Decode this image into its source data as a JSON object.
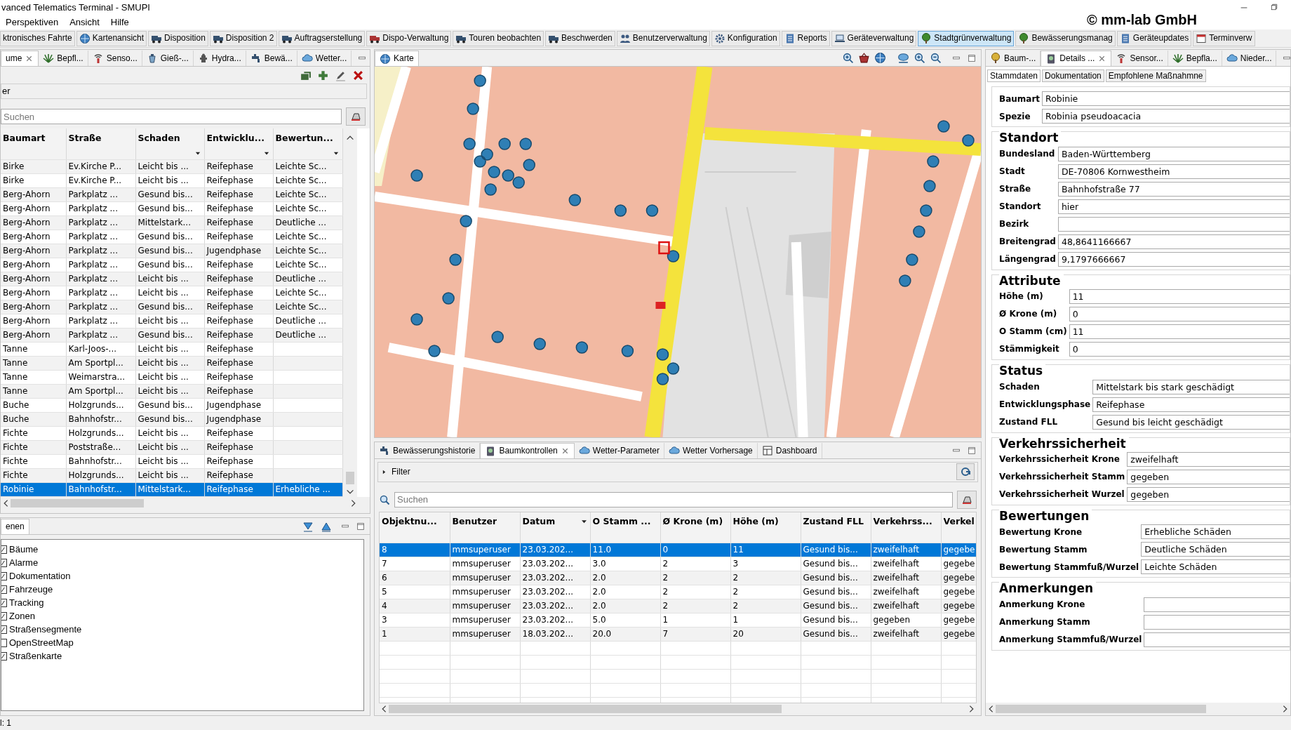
{
  "window": {
    "title": "vanced Telematics Terminal - SMUPI",
    "brand": "© mm-lab GmbH"
  },
  "menu": [
    "Perspektiven",
    "Ansicht",
    "Hilfe"
  ],
  "perspectives": [
    {
      "label": "ktronisches Fahrte",
      "selected": false
    },
    {
      "label": "Kartenansicht",
      "selected": false
    },
    {
      "label": "Disposition",
      "selected": false
    },
    {
      "label": "Disposition 2",
      "selected": false
    },
    {
      "label": "Auftragserstellung",
      "selected": false
    },
    {
      "label": "Dispo-Verwaltung",
      "selected": false
    },
    {
      "label": "Touren beobachten",
      "selected": false
    },
    {
      "label": "Beschwerden",
      "selected": false
    },
    {
      "label": "Benutzerverwaltung",
      "selected": false
    },
    {
      "label": "Konfiguration",
      "selected": false
    },
    {
      "label": "Reports",
      "selected": false
    },
    {
      "label": "Geräteverwaltung",
      "selected": false
    },
    {
      "label": "Stadtgrünverwaltung",
      "selected": true
    },
    {
      "label": "Bewässerungsmanag",
      "selected": false
    },
    {
      "label": "Geräteupdates",
      "selected": false
    },
    {
      "label": "Terminverw",
      "selected": false
    }
  ],
  "tree_panel": {
    "tabs": [
      {
        "label": "ume",
        "selected": true,
        "closable": true
      },
      {
        "label": "Bepfl...",
        "selected": false
      },
      {
        "label": "Senso...",
        "selected": false
      },
      {
        "label": "Gieß-...",
        "selected": false
      },
      {
        "label": "Hydra...",
        "selected": false
      },
      {
        "label": "Bewä...",
        "selected": false
      },
      {
        "label": "Wetter...",
        "selected": false
      }
    ],
    "filter_label": "er",
    "search": {
      "placeholder": "Suchen"
    },
    "table": {
      "columns": [
        {
          "label": "Baumart",
          "filter": false
        },
        {
          "label": "Straße",
          "filter": false
        },
        {
          "label": "Schaden",
          "filter": true
        },
        {
          "label": "Entwicklu...",
          "filter": true
        },
        {
          "label": "Bewertun...",
          "filter": true
        }
      ],
      "rows": [
        {
          "cells": [
            "Birke",
            "Ev.Kirche P...",
            "Leicht bis ...",
            "Reifephase",
            "Leichte Sc..."
          ],
          "selected": false
        },
        {
          "cells": [
            "Birke",
            "Ev.Kirche P...",
            "Leicht bis ...",
            "Reifephase",
            "Leichte Sc..."
          ],
          "selected": false
        },
        {
          "cells": [
            "Berg-Ahorn",
            "Parkplatz ...",
            "Gesund bis...",
            "Reifephase",
            "Leichte Sc..."
          ],
          "selected": false
        },
        {
          "cells": [
            "Berg-Ahorn",
            "Parkplatz ...",
            "Gesund bis...",
            "Reifephase",
            "Leichte Sc..."
          ],
          "selected": false
        },
        {
          "cells": [
            "Berg-Ahorn",
            "Parkplatz ...",
            "Mittelstark...",
            "Reifephase",
            "Deutliche ..."
          ],
          "selected": false
        },
        {
          "cells": [
            "Berg-Ahorn",
            "Parkplatz ...",
            "Gesund bis...",
            "Reifephase",
            "Leichte Sc..."
          ],
          "selected": false
        },
        {
          "cells": [
            "Berg-Ahorn",
            "Parkplatz ...",
            "Gesund bis...",
            "Jugendphase",
            "Leichte Sc..."
          ],
          "selected": false
        },
        {
          "cells": [
            "Berg-Ahorn",
            "Parkplatz ...",
            "Gesund bis...",
            "Reifephase",
            "Leichte Sc..."
          ],
          "selected": false
        },
        {
          "cells": [
            "Berg-Ahorn",
            "Parkplatz ...",
            "Leicht bis ...",
            "Reifephase",
            "Deutliche ..."
          ],
          "selected": false
        },
        {
          "cells": [
            "Berg-Ahorn",
            "Parkplatz ...",
            "Leicht bis ...",
            "Reifephase",
            "Leichte Sc..."
          ],
          "selected": false
        },
        {
          "cells": [
            "Berg-Ahorn",
            "Parkplatz ...",
            "Gesund bis...",
            "Reifephase",
            "Leichte Sc..."
          ],
          "selected": false
        },
        {
          "cells": [
            "Berg-Ahorn",
            "Parkplatz ...",
            "Leicht bis ...",
            "Reifephase",
            "Deutliche ..."
          ],
          "selected": false
        },
        {
          "cells": [
            "Berg-Ahorn",
            "Parkplatz ...",
            "Gesund bis...",
            "Reifephase",
            "Deutliche ..."
          ],
          "selected": false
        },
        {
          "cells": [
            "Tanne",
            "Karl-Joos-...",
            "Leicht bis ...",
            "Reifephase"
          ],
          "selected": false
        },
        {
          "cells": [
            "Tanne",
            "Am Sportpl...",
            "Leicht bis ...",
            "Reifephase"
          ],
          "selected": false
        },
        {
          "cells": [
            "Tanne",
            "Weimarstra...",
            "Leicht bis ...",
            "Reifephase"
          ],
          "selected": false
        },
        {
          "cells": [
            "Tanne",
            "Am Sportpl...",
            "Leicht bis ...",
            "Reifephase"
          ],
          "selected": false
        },
        {
          "cells": [
            "Buche",
            "Holzgrunds...",
            "Gesund bis...",
            "Jugendphase"
          ],
          "selected": false
        },
        {
          "cells": [
            "Buche",
            "Bahnhofstr...",
            "Gesund bis...",
            "Jugendphase"
          ],
          "selected": false
        },
        {
          "cells": [
            "Fichte",
            "Holzgrunds...",
            "Leicht bis ...",
            "Reifephase"
          ],
          "selected": false
        },
        {
          "cells": [
            "Fichte",
            "Poststraße...",
            "Leicht bis ...",
            "Reifephase"
          ],
          "selected": false
        },
        {
          "cells": [
            "Fichte",
            "Bahnhofstr...",
            "Leicht bis ...",
            "Reifephase"
          ],
          "selected": false
        },
        {
          "cells": [
            "Fichte",
            "Holzgrunds...",
            "Leicht bis ...",
            "Reifephase"
          ],
          "selected": false
        },
        {
          "cells": [
            "Robinie",
            "Bahnhofstr...",
            "Mittelstark...",
            "Reifephase",
            "Erhebliche ..."
          ],
          "selected": true
        }
      ]
    }
  },
  "layers_panel": {
    "tabs": [
      {
        "label": "enen",
        "selected": true
      }
    ],
    "items": [
      {
        "label": "Bäume",
        "checked": true
      },
      {
        "label": "Alarme",
        "checked": true
      },
      {
        "label": "Dokumentation",
        "checked": true
      },
      {
        "label": "Fahrzeuge",
        "checked": true
      },
      {
        "label": "Tracking",
        "checked": true
      },
      {
        "label": "Zonen",
        "checked": true
      },
      {
        "label": "Straßensegmente",
        "checked": true
      },
      {
        "label": "OpenStreetMap",
        "checked": false
      },
      {
        "label": "Straßenkarte",
        "checked": true
      }
    ]
  },
  "map_panel": {
    "tabs": [
      {
        "label": "Karte",
        "selected": true
      }
    ]
  },
  "controls_panel": {
    "tabs": [
      {
        "label": "Bewässerungshistorie",
        "selected": false
      },
      {
        "label": "Baumkontrollen",
        "selected": true,
        "closable": true
      },
      {
        "label": "Wetter-Parameter",
        "selected": false
      },
      {
        "label": "Wetter Vorhersage",
        "selected": false
      },
      {
        "label": "Dashboard",
        "selected": false
      }
    ],
    "filter": {
      "label": "Filter",
      "expanded": false
    },
    "search": {
      "placeholder": "Suchen"
    },
    "table": {
      "columns": [
        {
          "label": "Objektnu...",
          "sorted": false
        },
        {
          "label": "Benutzer",
          "sorted": false
        },
        {
          "label": "Datum",
          "sorted": true
        },
        {
          "label": "O Stamm ...",
          "sorted": false
        },
        {
          "label": "Ø Krone (m)",
          "sorted": false
        },
        {
          "label": "Höhe (m)",
          "sorted": false
        },
        {
          "label": "Zustand FLL",
          "sorted": false
        },
        {
          "label": "Verkehrss...",
          "sorted": false
        },
        {
          "label": "Verkel",
          "sorted": false
        }
      ],
      "rows": [
        {
          "cells": [
            "8",
            "mmsuperuser",
            "23.03.202...",
            "11.0",
            "0",
            "11",
            "Gesund bis...",
            "zweifelhaft",
            "gegebe"
          ],
          "selected": true
        },
        {
          "cells": [
            "7",
            "mmsuperuser",
            "23.03.202...",
            "3.0",
            "2",
            "3",
            "Gesund bis...",
            "zweifelhaft",
            "gegebe"
          ],
          "selected": false
        },
        {
          "cells": [
            "6",
            "mmsuperuser",
            "23.03.202...",
            "2.0",
            "2",
            "2",
            "Gesund bis...",
            "zweifelhaft",
            "gegebe"
          ],
          "selected": false
        },
        {
          "cells": [
            "5",
            "mmsuperuser",
            "23.03.202...",
            "2.0",
            "2",
            "2",
            "Gesund bis...",
            "zweifelhaft",
            "gegebe"
          ],
          "selected": false
        },
        {
          "cells": [
            "4",
            "mmsuperuser",
            "23.03.202...",
            "2.0",
            "2",
            "2",
            "Gesund bis...",
            "zweifelhaft",
            "gegebe"
          ],
          "selected": false
        },
        {
          "cells": [
            "3",
            "mmsuperuser",
            "23.03.202...",
            "5.0",
            "1",
            "1",
            "Gesund bis...",
            "gegeben",
            "gegebe"
          ],
          "selected": false
        },
        {
          "cells": [
            "1",
            "mmsuperuser",
            "18.03.202...",
            "20.0",
            "7",
            "20",
            "Gesund bis...",
            "zweifelhaft",
            "gegebe"
          ],
          "selected": false
        }
      ]
    }
  },
  "details_panel": {
    "tabs": [
      {
        "label": "Baum-...",
        "selected": false
      },
      {
        "label": "Details ...",
        "selected": true,
        "closable": true
      },
      {
        "label": "Sensor...",
        "selected": false
      },
      {
        "label": "Bepfla...",
        "selected": false
      },
      {
        "label": "Nieder...",
        "selected": false
      }
    ],
    "subtabs": [
      {
        "label": "Stammdaten",
        "selected": true
      },
      {
        "label": "Dokumentation",
        "selected": false
      },
      {
        "label": "Empfohlene Maßnahmne",
        "selected": false
      }
    ],
    "sections": [
      {
        "fields": [
          {
            "label": "Baumart",
            "value": "Robinie"
          },
          {
            "label": "Spezie",
            "value": "Robinia pseudoacacia"
          }
        ]
      },
      {
        "title": "Standort",
        "fields": [
          {
            "label": "Bundesland",
            "value": "Baden-Württemberg"
          },
          {
            "label": "Stadt",
            "value": "DE-70806 Kornwestheim"
          },
          {
            "label": "Straße",
            "value": "Bahnhofstraße 77"
          },
          {
            "label": "Standort",
            "value": "hier"
          },
          {
            "label": "Bezirk"
          },
          {
            "label": "Breitengrad",
            "value": "48,8641166667"
          },
          {
            "label": "Längengrad",
            "value": "9,1797666667"
          }
        ]
      },
      {
        "title": "Attribute",
        "fields": [
          {
            "label": "Höhe (m)",
            "value": "11"
          },
          {
            "label": "Ø Krone (m)",
            "value": "0"
          },
          {
            "label": "O Stamm (cm)",
            "value": "11"
          },
          {
            "label": "Stämmigkeit",
            "value": "0"
          }
        ]
      },
      {
        "title": "Status",
        "fields": [
          {
            "label": "Schaden",
            "value": "Mittelstark bis stark geschädigt"
          },
          {
            "label": "Entwicklungsphase",
            "value": "Reifephase"
          },
          {
            "label": "Zustand FLL",
            "value": "Gesund bis leicht geschädigt"
          }
        ]
      },
      {
        "title": "Verkehrssicherheit",
        "fields": [
          {
            "label": "Verkehrssicherheit Krone",
            "value": "zweifelhaft"
          },
          {
            "label": "Verkehrssicherheit Stamm",
            "value": "gegeben"
          },
          {
            "label": "Verkehrssicherheit Wurzel",
            "value": "gegeben"
          }
        ]
      },
      {
        "title": "Bewertungen",
        "fields": [
          {
            "label": "Bewertung Krone",
            "value": "Erhebliche Schäden"
          },
          {
            "label": "Bewertung Stamm",
            "value": "Deutliche Schäden"
          },
          {
            "label": "Bewertung Stammfuß/Wurzel",
            "value": "Leichte Schäden"
          }
        ]
      },
      {
        "title": "Anmerkungen",
        "fields": [
          {
            "label": "Anmerkung Krone"
          },
          {
            "label": "Anmerkung Stamm"
          },
          {
            "label": "Anmerkung Stammfuß/Wurzel"
          }
        ]
      }
    ]
  },
  "status_bar": "l: 1"
}
